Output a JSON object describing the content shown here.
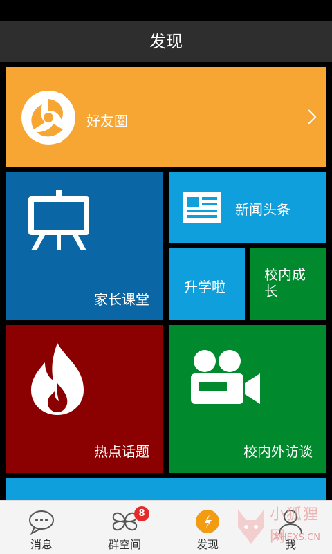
{
  "header": {
    "title": "发现"
  },
  "tiles": {
    "friends": {
      "label": "好友圈"
    },
    "parent_class": {
      "label": "家长课堂"
    },
    "news": {
      "label": "新闻头条"
    },
    "school_entry": {
      "label": "升学啦"
    },
    "school_growth": {
      "label": "校内成长"
    },
    "hot_topics": {
      "label": "热点话题"
    },
    "interview": {
      "label": "校内外访谈"
    }
  },
  "tabbar": {
    "tabs": [
      {
        "label": "消息",
        "icon": "chat-bubble-icon"
      },
      {
        "label": "群空间",
        "icon": "group-space-icon",
        "badge": "8"
      },
      {
        "label": "发现",
        "icon": "discover-compass-icon"
      },
      {
        "label": "我",
        "icon": "person-icon"
      }
    ]
  },
  "watermark": {
    "text_cn": "小狐狸网",
    "text_en": "XHEXS.CN"
  },
  "colors": {
    "orange": "#f7a634",
    "dark_blue": "#0a66a4",
    "light_blue": "#109fdd",
    "green": "#008a2d",
    "dark_red": "#8b0000",
    "badge_red": "#e32b2b",
    "discover_active": "#f39c12"
  }
}
